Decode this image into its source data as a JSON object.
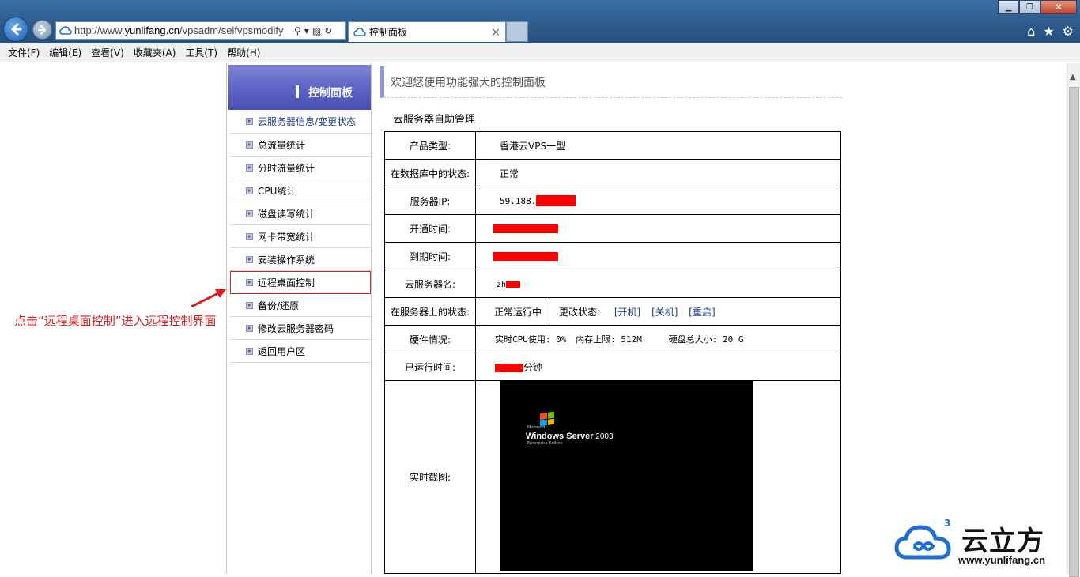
{
  "browser": {
    "address_prefix": "http://www.",
    "address_domain": "yunlifang.cn",
    "address_suffix": "/vpsadm/selfvpsmodify",
    "tab_title": "控制面板",
    "tab_close": "×"
  },
  "menu": [
    "文件(F)",
    "编辑(E)",
    "查看(V)",
    "收藏夹(A)",
    "工具(T)",
    "帮助(H)"
  ],
  "sidebar": {
    "title": "控制面板",
    "items": [
      {
        "label": "云服务器信息/变更状态"
      },
      {
        "label": "总流量统计"
      },
      {
        "label": "分时流量统计"
      },
      {
        "label": "CPU统计"
      },
      {
        "label": "磁盘读写统计"
      },
      {
        "label": "网卡带宽统计"
      },
      {
        "label": "安装操作系统"
      },
      {
        "label": "远程桌面控制"
      },
      {
        "label": "备份/还原"
      },
      {
        "label": "修改云服务器密码"
      },
      {
        "label": "返回用户区"
      }
    ]
  },
  "annotation": "点击“远程桌面控制”进入远程控制界面",
  "main": {
    "welcome": "欢迎您使用功能强大的控制面板",
    "section_title": "云服务器自助管理",
    "rows": {
      "product_type": {
        "label": "产品类型:",
        "value": "香港云VPS一型"
      },
      "db_status": {
        "label": "在数据库中的状态:",
        "value": "正常"
      },
      "ip": {
        "label": "服务器IP:",
        "value": "59.188."
      },
      "open_time": {
        "label": "开通时间:"
      },
      "expire_time": {
        "label": "到期时间:"
      },
      "server_name": {
        "label": "云服务器名:",
        "value": "zh"
      },
      "server_status": {
        "label": "在服务器上的状态:",
        "value": "正常运行中",
        "change_label": "更改状态:",
        "actions": [
          "[开机]",
          "[关机]",
          "[重启]"
        ]
      },
      "hardware": {
        "label": "硬件情况:",
        "cpu": "实时CPU使用: 0%",
        "memory": "内存上限: 512M",
        "disk": "硬盘总大小: 20 G"
      },
      "uptime": {
        "label": "已运行时间:",
        "unit": "分钟"
      },
      "screenshot": {
        "label": "实时截图:",
        "os_brand": "Microsoft",
        "os_name": "Windows Server",
        "os_version": "2003",
        "os_edition": "Enterprise Edition"
      }
    }
  },
  "watermark": {
    "text": "云立方",
    "url": "www.yunlifang.cn",
    "sup": "3"
  },
  "colors": {
    "accent": "#5c63c4",
    "annotation_red": "#d42020",
    "redact": "#ff0000",
    "link": "#1a3c8c"
  }
}
